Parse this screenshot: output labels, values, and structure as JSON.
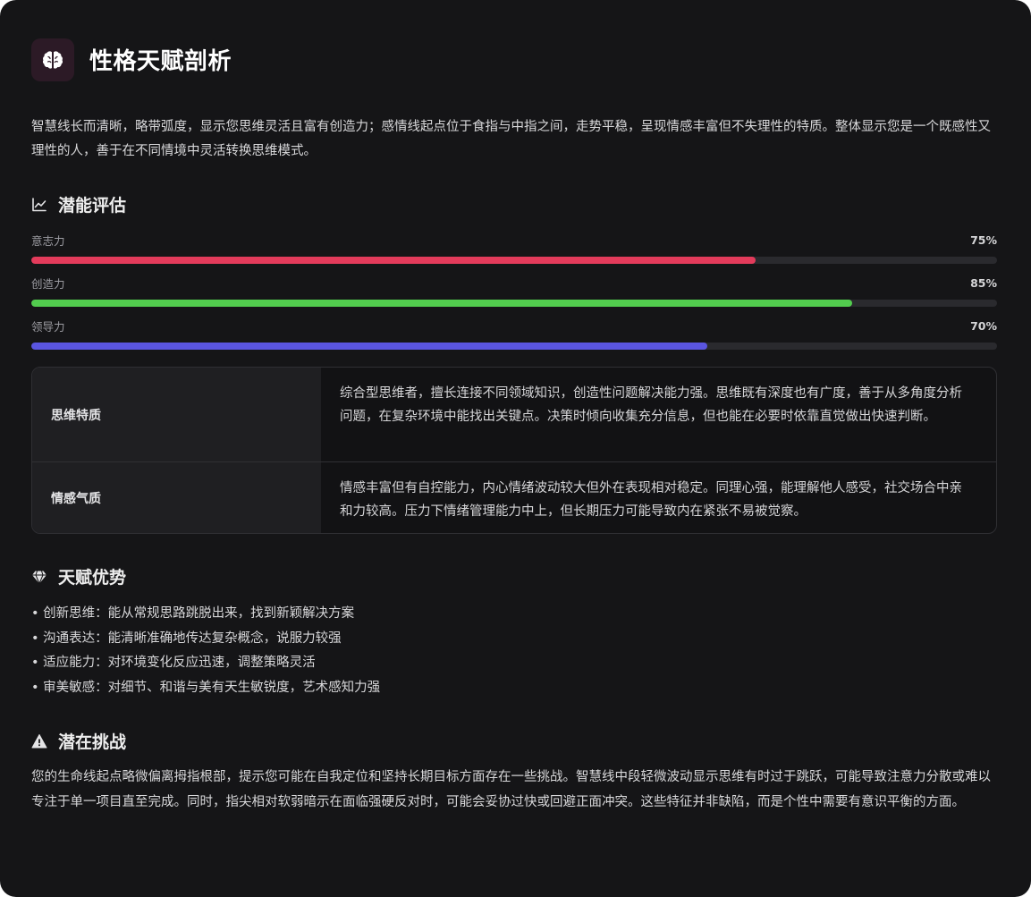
{
  "header": {
    "title": "性格天赋剖析",
    "icon": "brain-icon",
    "icon_bg": "#2c1a26",
    "icon_color": "#ffffff"
  },
  "intro": "智慧线长而清晰，略带弧度，显示您思维灵活且富有创造力；感情线起点位于食指与中指之间，走势平稳，呈现情感丰富但不失理性的特质。整体显示您是一个既感性又理性的人，善于在不同情境中灵活转换思维模式。",
  "potential": {
    "heading": "潜能评估",
    "icon": "trending-chart-icon",
    "metrics": [
      {
        "label": "意志力",
        "percent_text": "75%",
        "value": 0.75,
        "color": "#e33b5b"
      },
      {
        "label": "创造力",
        "percent_text": "85%",
        "value": 0.85,
        "color": "#52cc4e"
      },
      {
        "label": "领导力",
        "percent_text": "70%",
        "value": 0.7,
        "color": "#5a55e0"
      }
    ]
  },
  "traits": [
    {
      "key": "思维特质",
      "value": "综合型思维者，擅长连接不同领域知识，创造性问题解决能力强。思维既有深度也有广度，善于从多角度分析问题，在复杂环境中能找出关键点。决策时倾向收集充分信息，但也能在必要时依靠直觉做出快速判断。"
    },
    {
      "key": "情感气质",
      "value": "情感丰富但有自控能力，内心情绪波动较大但外在表现相对稳定。同理心强，能理解他人感受，社交场合中亲和力较高。压力下情绪管理能力中上，但长期压力可能导致内在紧张不易被觉察。"
    }
  ],
  "talents": {
    "heading": "天赋优势",
    "icon": "diamond-icon",
    "items": [
      "创新思维：能从常规思路跳脱出来，找到新颖解决方案",
      "沟通表达：能清晰准确地传达复杂概念，说服力较强",
      "适应能力：对环境变化反应迅速，调整策略灵活",
      "审美敏感：对细节、和谐与美有天生敏锐度，艺术感知力强"
    ]
  },
  "challenges": {
    "heading": "潜在挑战",
    "icon": "warning-icon",
    "text": "您的生命线起点略微偏离拇指根部，提示您可能在自我定位和坚持长期目标方面存在一些挑战。智慧线中段轻微波动显示思维有时过于跳跃，可能导致注意力分散或难以专注于单一项目直至完成。同时，指尖相对软弱暗示在面临强硬反对时，可能会妥协过快或回避正面冲突。这些特征并非缺陷，而是个性中需要有意识平衡的方面。"
  }
}
